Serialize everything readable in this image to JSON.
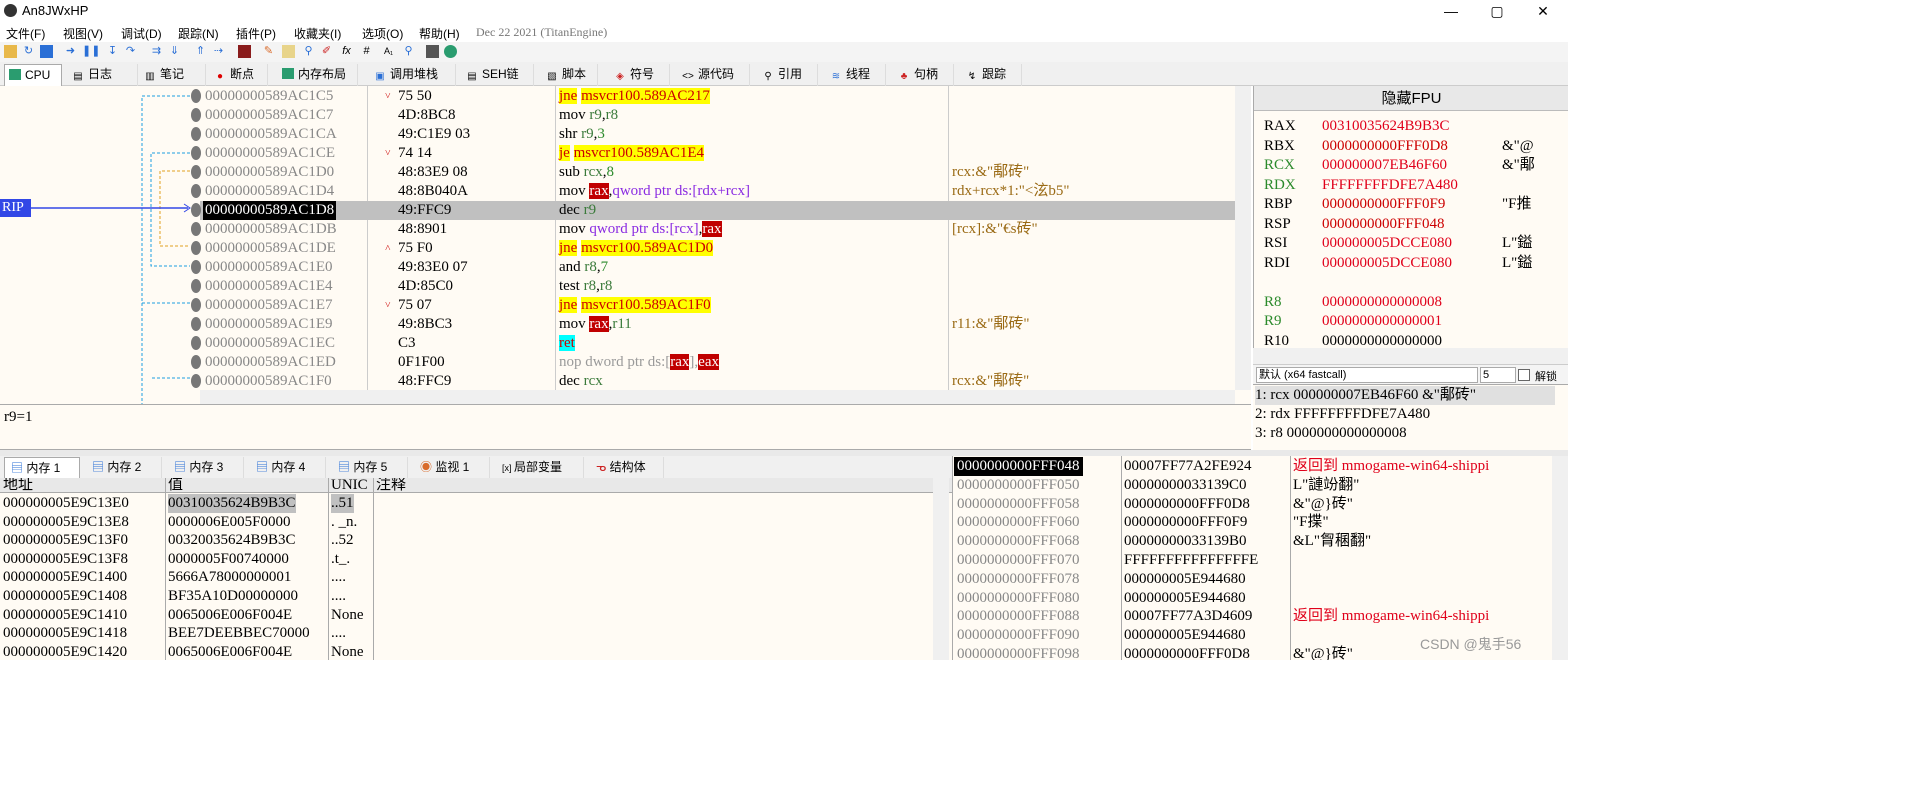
{
  "window": {
    "title": "An8JWxHP",
    "minimize": "—",
    "maximize": "▢",
    "close": "✕"
  },
  "menu": {
    "items": [
      "文件(F)",
      "视图(V)",
      "调试(D)",
      "跟踪(N)",
      "插件(P)",
      "收藏夹(I)",
      "选项(O)",
      "帮助(H)"
    ],
    "build_date": "Dec 22 2021 (TitanEngine)"
  },
  "tabs": [
    "CPU",
    "日志",
    "笔记",
    "断点",
    "内存布局",
    "调用堆栈",
    "SEH链",
    "脚本",
    "符号",
    "源代码",
    "引用",
    "线程",
    "句柄",
    "跟踪"
  ],
  "disasm": {
    "rip_label": "RIP",
    "rows": [
      {
        "addr": "00000000589AC1C5",
        "mark": "˅",
        "bytes": "75 50",
        "ins": [
          {
            "t": "jne",
            "c": "hl-y"
          },
          {
            "t": " "
          },
          {
            "t": "msvcr100.589AC217",
            "c": "hl-y"
          }
        ],
        "cmt": ""
      },
      {
        "addr": "00000000589AC1C7",
        "mark": "",
        "bytes": "4D:8BC8",
        "ins": [
          {
            "t": "mov "
          },
          {
            "t": "r9",
            "c": "r"
          },
          {
            "t": ","
          },
          {
            "t": "r8",
            "c": "r"
          }
        ],
        "cmt": ""
      },
      {
        "addr": "00000000589AC1CA",
        "mark": "",
        "bytes": "49:C1E9 03",
        "ins": [
          {
            "t": "shr "
          },
          {
            "t": "r9",
            "c": "r"
          },
          {
            "t": ","
          },
          {
            "t": "3",
            "c": "g"
          }
        ],
        "cmt": ""
      },
      {
        "addr": "00000000589AC1CE",
        "mark": "˅",
        "bytes": "74 14",
        "ins": [
          {
            "t": "je",
            "c": "hl-y"
          },
          {
            "t": " "
          },
          {
            "t": "msvcr100.589AC1E4",
            "c": "hl-y"
          }
        ],
        "cmt": ""
      },
      {
        "addr": "00000000589AC1D0",
        "mark": "",
        "bytes": "48:83E9 08",
        "ins": [
          {
            "t": "sub "
          },
          {
            "t": "rcx",
            "c": "r"
          },
          {
            "t": ","
          },
          {
            "t": "8",
            "c": "g"
          }
        ],
        "cmt": "rcx:&\"鄅砖\""
      },
      {
        "addr": "00000000589AC1D4",
        "mark": "",
        "bytes": "48:8B040A",
        "ins": [
          {
            "t": "mov "
          },
          {
            "t": "rax",
            "c": "hl-r"
          },
          {
            "t": ","
          },
          {
            "t": "qword ptr ",
            "c": "p"
          },
          {
            "t": "ds:",
            "c": "p"
          },
          {
            "t": "[rdx+rcx]",
            "c": "p"
          }
        ],
        "cmt": "rdx+rcx*1:\"<泫b5\""
      },
      {
        "addr": "00000000589AC1D8",
        "mark": "",
        "bytes": "49:FFC9",
        "ins": [
          {
            "t": "dec "
          },
          {
            "t": "r9",
            "c": "r"
          }
        ],
        "cmt": "",
        "current": true
      },
      {
        "addr": "00000000589AC1DB",
        "mark": "",
        "bytes": "48:8901",
        "ins": [
          {
            "t": "mov "
          },
          {
            "t": "qword ptr ",
            "c": "p"
          },
          {
            "t": "ds:",
            "c": "p"
          },
          {
            "t": "[rcx]",
            "c": "p"
          },
          {
            "t": ","
          },
          {
            "t": "rax",
            "c": "hl-r"
          }
        ],
        "cmt": "[rcx]:&\"€s砖\""
      },
      {
        "addr": "00000000589AC1DE",
        "mark": "˄",
        "bytes": "75 F0",
        "ins": [
          {
            "t": "jne",
            "c": "hl-y"
          },
          {
            "t": " "
          },
          {
            "t": "msvcr100.589AC1D0",
            "c": "hl-y"
          }
        ],
        "cmt": ""
      },
      {
        "addr": "00000000589AC1E0",
        "mark": "",
        "bytes": "49:83E0 07",
        "ins": [
          {
            "t": "and "
          },
          {
            "t": "r8",
            "c": "r"
          },
          {
            "t": ","
          },
          {
            "t": "7",
            "c": "g"
          }
        ],
        "cmt": ""
      },
      {
        "addr": "00000000589AC1E4",
        "mark": "",
        "bytes": "4D:85C0",
        "ins": [
          {
            "t": "test "
          },
          {
            "t": "r8",
            "c": "r"
          },
          {
            "t": ","
          },
          {
            "t": "r8",
            "c": "r"
          }
        ],
        "cmt": ""
      },
      {
        "addr": "00000000589AC1E7",
        "mark": "˅",
        "bytes": "75 07",
        "ins": [
          {
            "t": "jne",
            "c": "hl-y"
          },
          {
            "t": " "
          },
          {
            "t": "msvcr100.589AC1F0",
            "c": "hl-y"
          }
        ],
        "cmt": ""
      },
      {
        "addr": "00000000589AC1E9",
        "mark": "",
        "bytes": "49:8BC3",
        "ins": [
          {
            "t": "mov "
          },
          {
            "t": "rax",
            "c": "hl-r"
          },
          {
            "t": ","
          },
          {
            "t": "r11",
            "c": "r"
          }
        ],
        "cmt": "r11:&\"鄅砖\""
      },
      {
        "addr": "00000000589AC1EC",
        "mark": "",
        "bytes": "C3",
        "ins": [
          {
            "t": "ret",
            "c": "hl-c"
          }
        ],
        "cmt": ""
      },
      {
        "addr": "00000000589AC1ED",
        "mark": "",
        "bytes": "0F1F00",
        "ins": [
          {
            "t": "nop dword ptr ds:[",
            "c": "nop"
          },
          {
            "t": "rax",
            "c": "hl-r"
          },
          {
            "t": "],",
            "c": "nop"
          },
          {
            "t": "eax",
            "c": "hl-r"
          }
        ],
        "cmt": ""
      },
      {
        "addr": "00000000589AC1F0",
        "mark": "",
        "bytes": "48:FFC9",
        "ins": [
          {
            "t": "dec "
          },
          {
            "t": "rcx",
            "c": "r"
          }
        ],
        "cmt": "rcx:&\"鄅砖\""
      }
    ]
  },
  "info": "r9=1",
  "registers": {
    "title": "隐藏FPU",
    "rows": [
      {
        "name": "RAX",
        "value": "00310035624B9B3C",
        "cmt": ""
      },
      {
        "name": "RBX",
        "value": "0000000000FFF0D8",
        "cmt": "&\"@"
      },
      {
        "name": "RCX",
        "value": "000000007EB46F60",
        "cmt": "&\"鄅"
      },
      {
        "name": "RDX",
        "value": "FFFFFFFFDFE7A480",
        "cmt": ""
      },
      {
        "name": "RBP",
        "value": "0000000000FFF0F9",
        "cmt": "\"F推"
      },
      {
        "name": "RSP",
        "value": "0000000000FFF048",
        "cmt": ""
      },
      {
        "name": "RSI",
        "value": "000000005DCCE080",
        "cmt": "L\"鎰"
      },
      {
        "name": "RDI",
        "value": "000000005DCCE080",
        "cmt": "L\"鎰"
      },
      {
        "name": "",
        "value": "",
        "cmt": ""
      },
      {
        "name": "R8",
        "value": "0000000000000008",
        "cmt": ""
      },
      {
        "name": "R9",
        "value": "0000000000000001",
        "cmt": ""
      },
      {
        "name": "R10",
        "value": "0000000000000000",
        "cmt": ""
      }
    ],
    "callconv": "默认 (x64 fastcall)",
    "argcount": "5",
    "unlock_label": "解锁"
  },
  "args": [
    "1: rcx 000000007EB46F60 &\"鄅砖\"",
    "2: rdx FFFFFFFFDFE7A480",
    "3: r8 0000000000000008"
  ],
  "dump_tabs": [
    "内存 1",
    "内存 2",
    "内存 3",
    "内存 4",
    "内存 5",
    "监视 1",
    "局部变量",
    "结构体"
  ],
  "dump": {
    "headers": [
      "地址",
      "值",
      "UNIC",
      "注释"
    ],
    "rows": [
      {
        "a": "000000005E9C13E0",
        "v": "00310035624B9B3C",
        "u": "..51"
      },
      {
        "a": "000000005E9C13E8",
        "v": "0000006E005F0000",
        "u": ". _n."
      },
      {
        "a": "000000005E9C13F0",
        "v": "00320035624B9B3C",
        "u": "..52"
      },
      {
        "a": "000000005E9C13F8",
        "v": "0000005F00740000",
        "u": ".t_."
      },
      {
        "a": "000000005E9C1400",
        "v": "5666A78000000001",
        "u": "...."
      },
      {
        "a": "000000005E9C1408",
        "v": "BF35A10D00000000",
        "u": "...."
      },
      {
        "a": "000000005E9C1410",
        "v": "0065006E006F004E",
        "u": "None"
      },
      {
        "a": "000000005E9C1418",
        "v": "BEE7DEEBBEC70000",
        "u": "...."
      },
      {
        "a": "000000005E9C1420",
        "v": "0065006E006F004E",
        "u": "None"
      }
    ]
  },
  "stack": {
    "rows": [
      {
        "a": "0000000000FFF048",
        "v": "00007FF77A2FE924",
        "c": "返回到 mmogame-win64-shippi",
        "ret": true,
        "top": true
      },
      {
        "a": "0000000000FFF050",
        "v": "00000000033139C0",
        "c": "L\"謰竕翻\""
      },
      {
        "a": "0000000000FFF058",
        "v": "0000000000FFF0D8",
        "c": "&\"@}砖\""
      },
      {
        "a": "0000000000FFF060",
        "v": "0000000000FFF0F9",
        "c": "\"F揲\""
      },
      {
        "a": "0000000000FFF068",
        "v": "00000000033139B0",
        "c": "&L\"胷稛翻\""
      },
      {
        "a": "0000000000FFF070",
        "v": "FFFFFFFFFFFFFFFE",
        "c": ""
      },
      {
        "a": "0000000000FFF078",
        "v": "000000005E944680",
        "c": ""
      },
      {
        "a": "0000000000FFF080",
        "v": "000000005E944680",
        "c": ""
      },
      {
        "a": "0000000000FFF088",
        "v": "00007FF77A3D4609",
        "c": "返回到 mmogame-win64-shippi",
        "ret": true
      },
      {
        "a": "0000000000FFF090",
        "v": "000000005E944680",
        "c": ""
      },
      {
        "a": "0000000000FFF098",
        "v": "0000000000FFF0D8",
        "c": "&\"@}砖\""
      }
    ]
  },
  "watermark": "CSDN @鬼手56"
}
